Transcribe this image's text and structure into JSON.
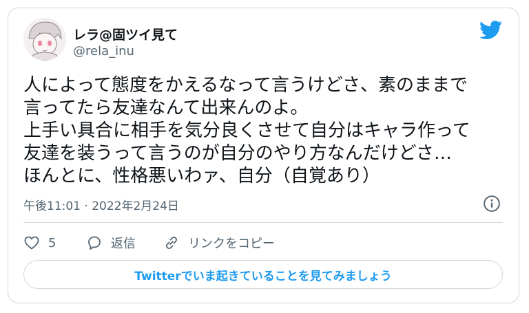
{
  "user": {
    "display_name": "レラ@固ツイ見て",
    "handle": "@rela_inu"
  },
  "tweet": {
    "lines": [
      "人によって態度をかえるなって言うけどさ、素のままで",
      "言ってたら友達なんて出来んのよ。",
      "上手い具合に相手を気分良くさせて自分はキャラ作って",
      "友達を装うって言うのが自分のやり方なんだけどさ…",
      "ほんとに、性格悪いわァ、自分（自覚あり）"
    ],
    "timestamp": "午後11:01 · 2022年2月24日"
  },
  "actions": {
    "like_count": "5",
    "reply_label": "返信",
    "copy_link_label": "リンクをコピー"
  },
  "cta": {
    "label": "Twitterでいま起きていることを見てみましょう"
  },
  "colors": {
    "accent": "#1d9bf0",
    "secondary_text": "#536471",
    "border": "#cfd9de"
  },
  "icons": [
    "twitter-bird-icon",
    "info-icon",
    "heart-icon",
    "reply-icon",
    "link-icon"
  ]
}
